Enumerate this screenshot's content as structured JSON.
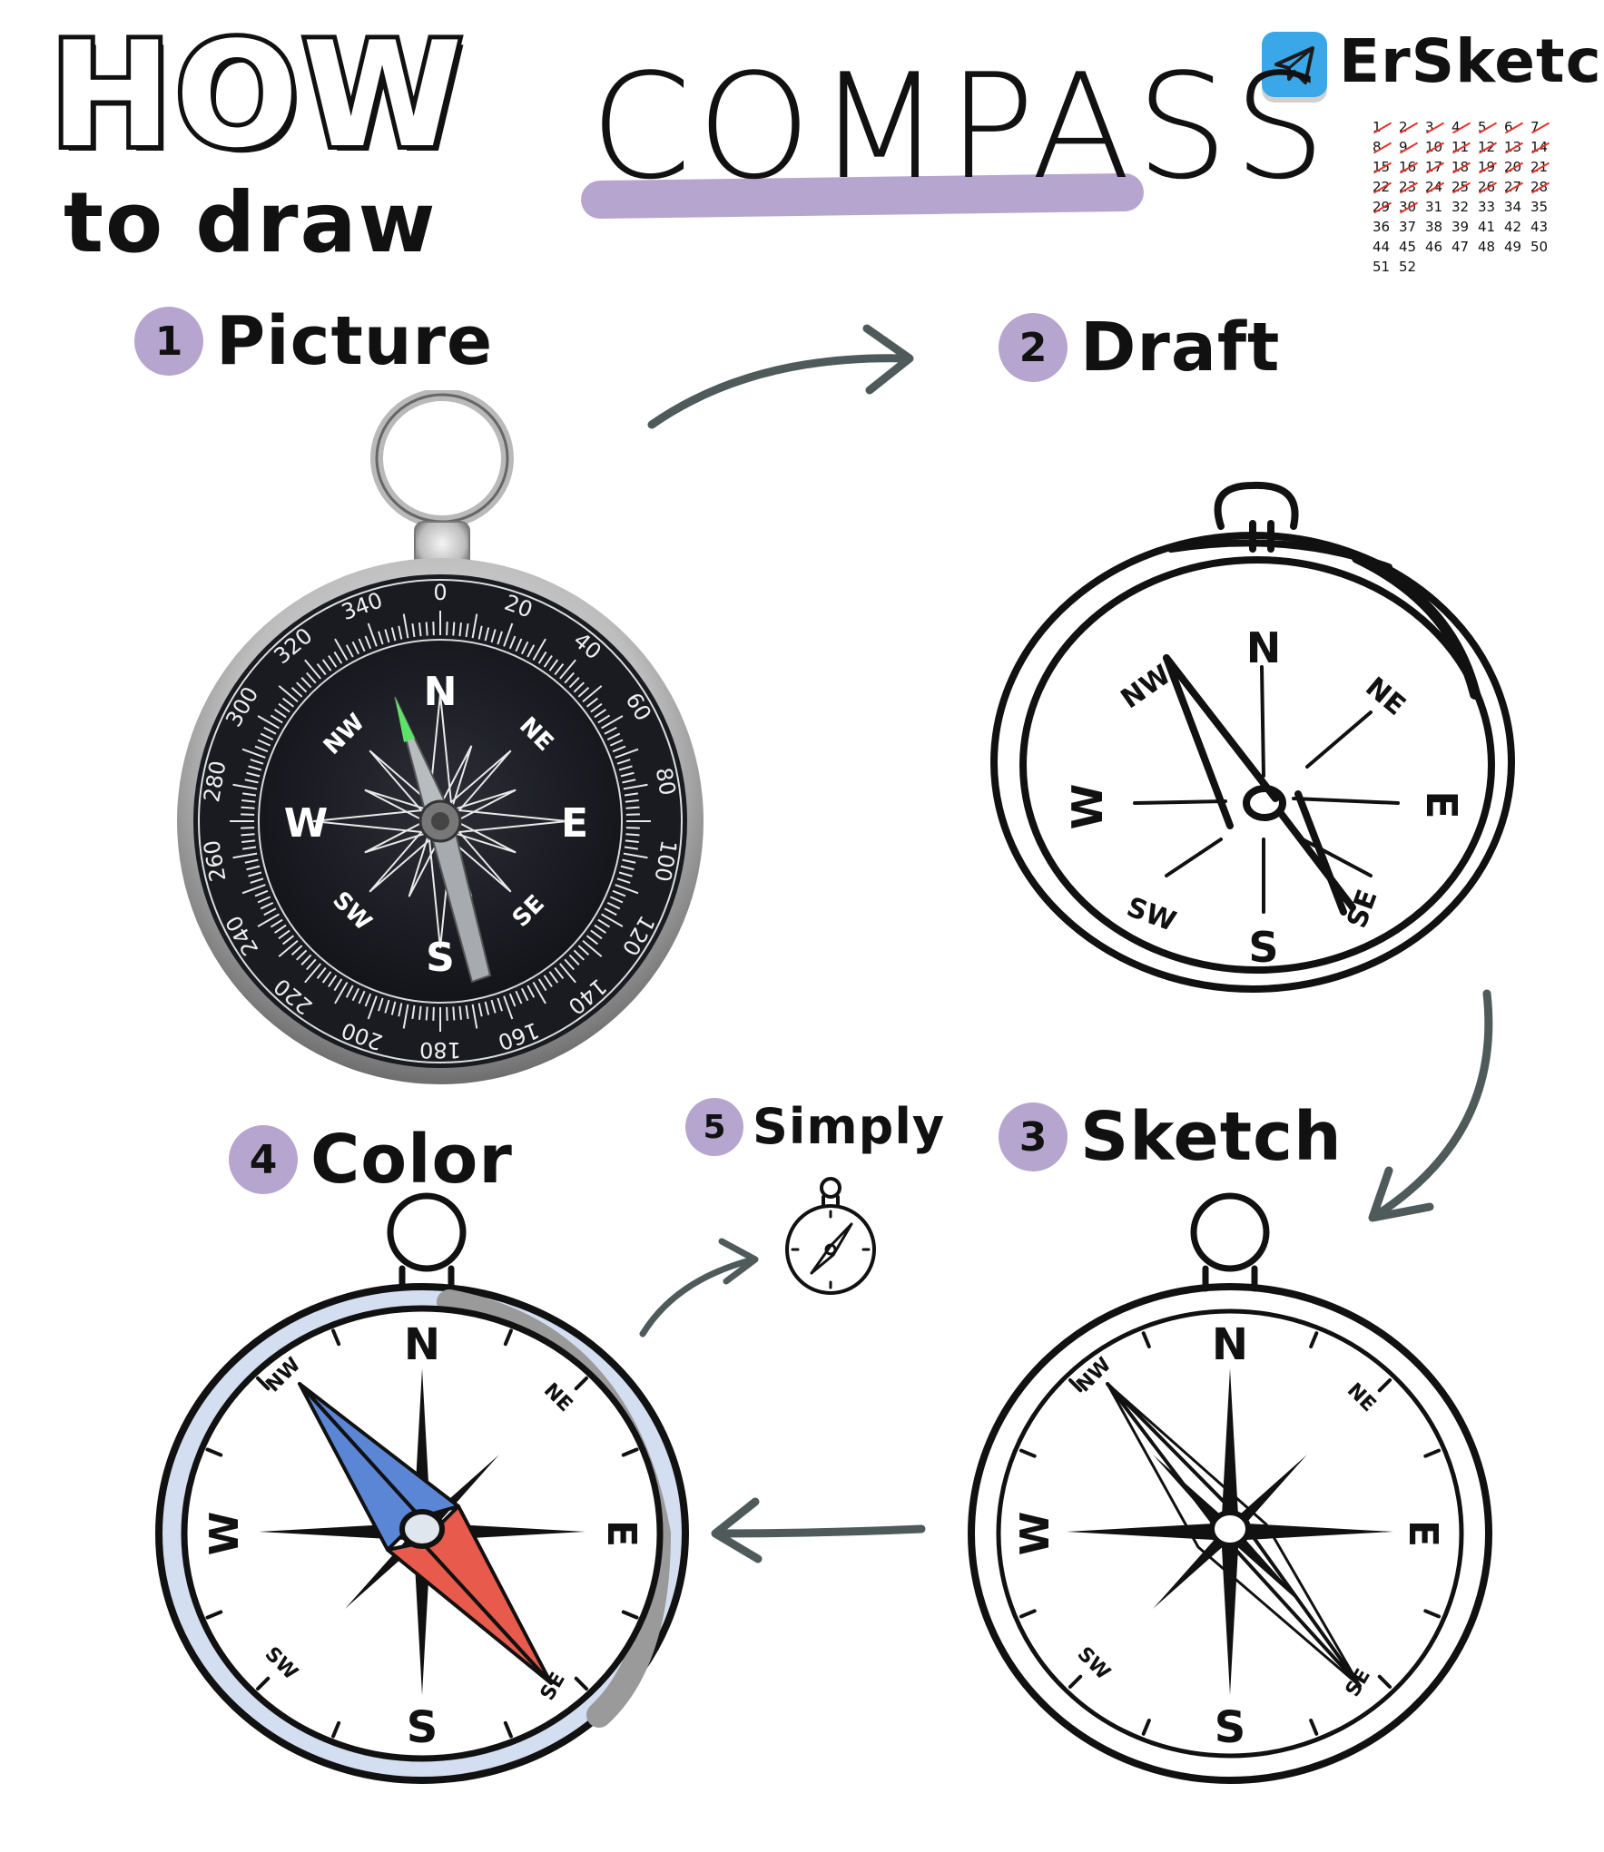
{
  "header": {
    "how": "HOW",
    "to_draw": "to draw",
    "title": "COMPASS"
  },
  "brand": {
    "name": "ErSketch",
    "icon": "paper-plane-icon"
  },
  "week_tracker": {
    "weeks": [
      "1",
      "2",
      "3",
      "4",
      "5",
      "6",
      "7",
      "8",
      "9",
      "10",
      "11",
      "12",
      "13",
      "14",
      "15",
      "16",
      "17",
      "18",
      "19",
      "20",
      "21",
      "22",
      "23",
      "24",
      "25",
      "26",
      "27",
      "28",
      "29",
      "30",
      "31",
      "32",
      "33",
      "34",
      "35",
      "36",
      "37",
      "38",
      "39",
      "41",
      "42",
      "43",
      "44",
      "45",
      "46",
      "47",
      "48",
      "49",
      "50",
      "51",
      "52"
    ],
    "crossed_out_through": "30",
    "cross_color": "#e2342a"
  },
  "steps": [
    {
      "number": "1",
      "label": "Picture"
    },
    {
      "number": "2",
      "label": "Draft"
    },
    {
      "number": "3",
      "label": "Sketch"
    },
    {
      "number": "4",
      "label": "Color"
    },
    {
      "number": "5",
      "label": "Simply"
    }
  ],
  "compass": {
    "cardinal": {
      "n": "N",
      "e": "E",
      "s": "S",
      "w": "W"
    },
    "intercardinal": {
      "ne": "NE",
      "se": "SE",
      "sw": "SW",
      "nw": "NW"
    },
    "degrees": [
      "0",
      "20",
      "40",
      "60",
      "80",
      "100",
      "120",
      "140",
      "160",
      "180",
      "200",
      "220",
      "240",
      "260",
      "280",
      "300",
      "320",
      "340"
    ]
  },
  "colors": {
    "accent_purple": "#b6a6cf",
    "arrow": "#4f5a5a",
    "needle_north": "#5b86d6",
    "needle_south": "#e75a4c",
    "bezel_blue": "#d3def0",
    "bezel_shadow": "#9a9a9a",
    "brand_blue": "#3aa8e8",
    "needle_glow": "#5ee36a"
  }
}
